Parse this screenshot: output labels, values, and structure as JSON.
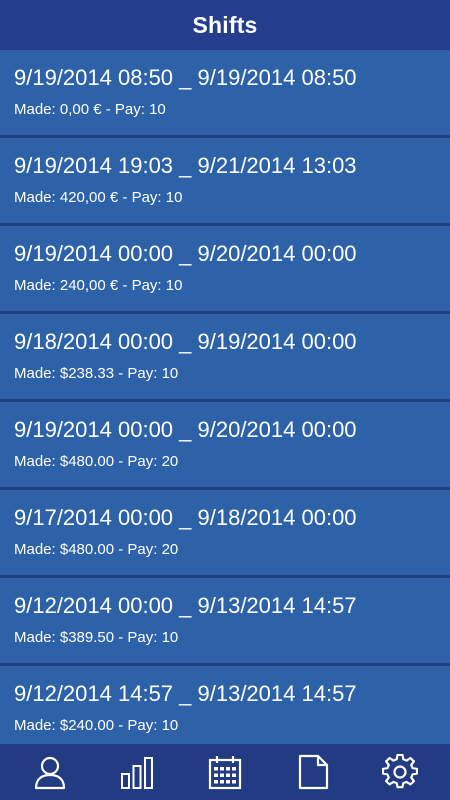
{
  "header": {
    "title": "Shifts"
  },
  "shifts": [
    {
      "range": "9/19/2014 08:50 _ 9/19/2014 08:50",
      "detail": "Made: 0,00 € - Pay: 10"
    },
    {
      "range": "9/19/2014 19:03 _ 9/21/2014 13:03",
      "detail": "Made: 420,00 € - Pay: 10"
    },
    {
      "range": "9/19/2014 00:00 _ 9/20/2014 00:00",
      "detail": "Made: 240,00 € - Pay: 10"
    },
    {
      "range": "9/18/2014 00:00 _ 9/19/2014 00:00",
      "detail": "Made: $238.33 - Pay: 10"
    },
    {
      "range": "9/19/2014 00:00 _ 9/20/2014 00:00",
      "detail": "Made: $480.00 - Pay: 20"
    },
    {
      "range": "9/17/2014 00:00 _ 9/18/2014 00:00",
      "detail": "Made: $480.00 - Pay: 20"
    },
    {
      "range": "9/12/2014 00:00 _ 9/13/2014 14:57",
      "detail": "Made: $389.50 - Pay: 10"
    },
    {
      "range": "9/12/2014 14:57 _ 9/13/2014 14:57",
      "detail": "Made: $240.00 - Pay: 10"
    }
  ],
  "tabbar": {
    "tabs": [
      {
        "icon": "person-icon"
      },
      {
        "icon": "bar-chart-icon"
      },
      {
        "icon": "calendar-icon"
      },
      {
        "icon": "document-icon"
      },
      {
        "icon": "gear-icon"
      }
    ]
  },
  "colors": {
    "header_bg": "#243d8c",
    "item_bg": "#2d62a8",
    "separator": "#1f3f7f",
    "tabbar_bg": "#233b82",
    "text": "#ffffff"
  }
}
